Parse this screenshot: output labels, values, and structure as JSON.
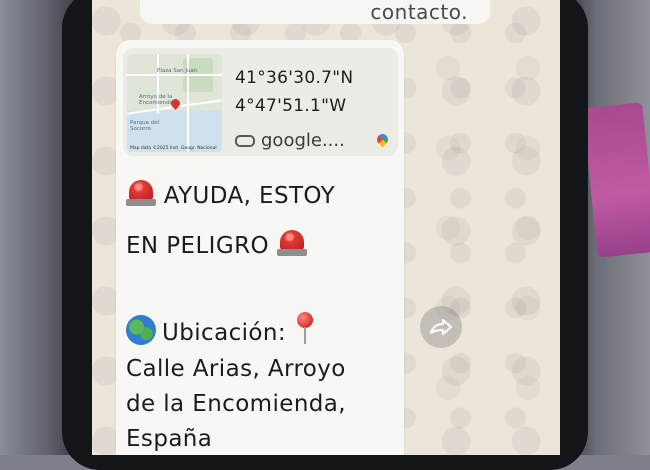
{
  "previous_message": {
    "text_tail": "contacto."
  },
  "location_card": {
    "latitude": "41°36'30.7\"N",
    "longitude": "4°47'51.1\"W",
    "link_text": "google....",
    "map_icon": "google-maps-pin-icon"
  },
  "message": {
    "line1": "AYUDA, ESTOY",
    "line2": "EN PELIGRO",
    "location_label": "Ubicación:",
    "address_line1": "Calle Arias, Arroyo",
    "address_line2": "de la Encomienda,",
    "address_line3": "España",
    "icons": [
      "siren-icon",
      "globe-icon",
      "round-pushpin-icon"
    ]
  },
  "actions": {
    "forward_icon": "forward-icon"
  },
  "colors": {
    "chat_background": "#ece5da",
    "bubble_background": "#f7f7f4",
    "siren_red": "#e53935"
  }
}
